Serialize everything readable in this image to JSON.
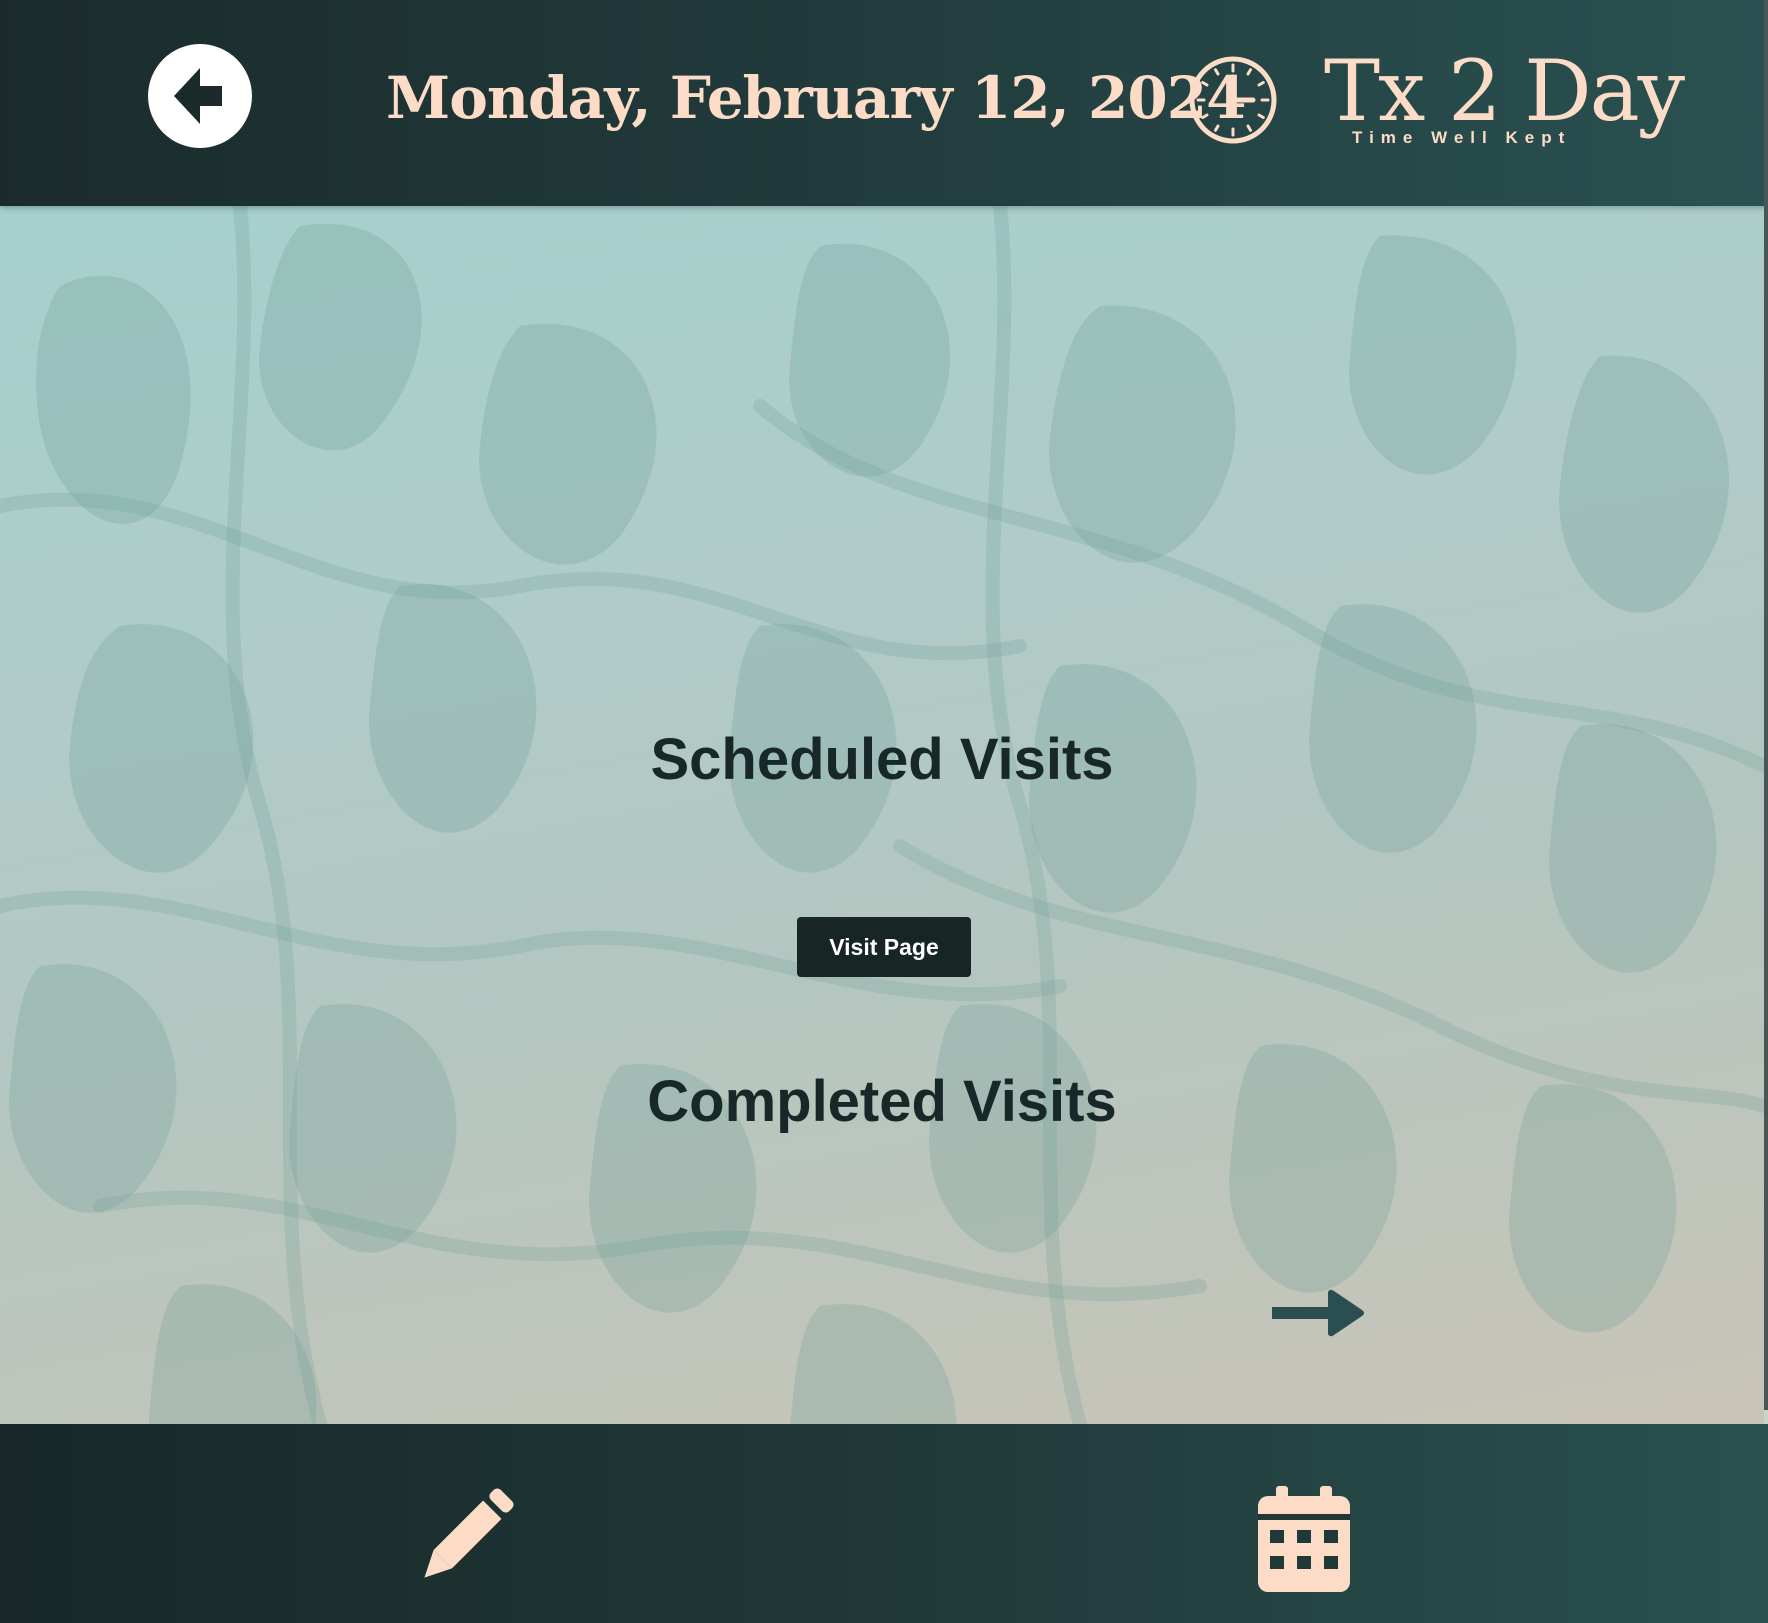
{
  "header": {
    "back_icon": "arrow-left-circle-icon",
    "date": "Monday, February 12, 2024",
    "clock_icon": "clock-icon",
    "logo": {
      "name": "Tx 2 Day",
      "tagline": "Time Well Kept"
    }
  },
  "main": {
    "scheduled_title": "Scheduled Visits",
    "visit_button_label": "Visit Page",
    "completed_title": "Completed Visits",
    "next_icon": "arrow-right-icon"
  },
  "footer": {
    "edit_icon": "pencil-icon",
    "calendar_icon": "calendar-icon"
  },
  "colors": {
    "header_bg": "#1e3333",
    "accent_peach": "#fcdcc6",
    "title_text": "#182828",
    "button_bg": "#172525",
    "arrow": "#2b4f50"
  }
}
